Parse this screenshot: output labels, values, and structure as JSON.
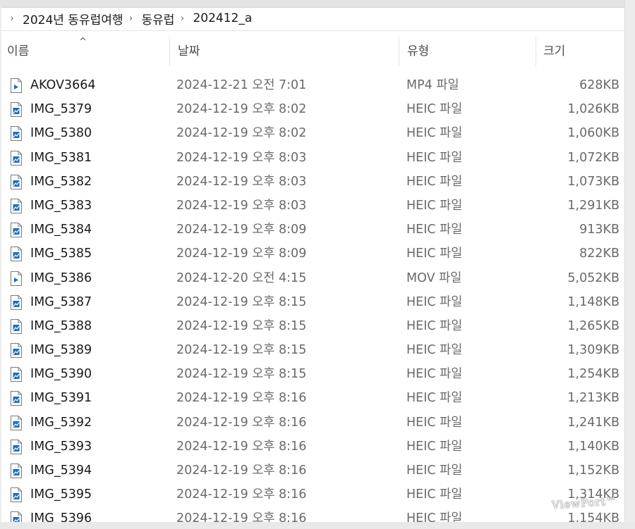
{
  "breadcrumb": {
    "items": [
      "2024년 동유럽여행",
      "동유럽",
      "202412_a"
    ]
  },
  "columns": {
    "name": "이름",
    "date": "날짜",
    "type": "유형",
    "size": "크기"
  },
  "sort": {
    "column": "name",
    "direction": "ascending",
    "icon": "chevron-up-icon"
  },
  "files": [
    {
      "name": "AKOV3664",
      "date": "2024-12-21 오전 7:01",
      "type": "MP4 파일",
      "size": "628KB",
      "icon": "video-file-icon"
    },
    {
      "name": "IMG_5379",
      "date": "2024-12-19 오후 8:02",
      "type": "HEIC 파일",
      "size": "1,026KB",
      "icon": "image-file-icon"
    },
    {
      "name": "IMG_5380",
      "date": "2024-12-19 오후 8:02",
      "type": "HEIC 파일",
      "size": "1,060KB",
      "icon": "image-file-icon"
    },
    {
      "name": "IMG_5381",
      "date": "2024-12-19 오후 8:03",
      "type": "HEIC 파일",
      "size": "1,072KB",
      "icon": "image-file-icon"
    },
    {
      "name": "IMG_5382",
      "date": "2024-12-19 오후 8:03",
      "type": "HEIC 파일",
      "size": "1,073KB",
      "icon": "image-file-icon"
    },
    {
      "name": "IMG_5383",
      "date": "2024-12-19 오후 8:03",
      "type": "HEIC 파일",
      "size": "1,291KB",
      "icon": "image-file-icon"
    },
    {
      "name": "IMG_5384",
      "date": "2024-12-19 오후 8:09",
      "type": "HEIC 파일",
      "size": "913KB",
      "icon": "image-file-icon"
    },
    {
      "name": "IMG_5385",
      "date": "2024-12-19 오후 8:09",
      "type": "HEIC 파일",
      "size": "822KB",
      "icon": "image-file-icon"
    },
    {
      "name": "IMG_5386",
      "date": "2024-12-20 오전 4:15",
      "type": "MOV 파일",
      "size": "5,052KB",
      "icon": "video-file-icon"
    },
    {
      "name": "IMG_5387",
      "date": "2024-12-19 오후 8:15",
      "type": "HEIC 파일",
      "size": "1,148KB",
      "icon": "image-file-icon"
    },
    {
      "name": "IMG_5388",
      "date": "2024-12-19 오후 8:15",
      "type": "HEIC 파일",
      "size": "1,265KB",
      "icon": "image-file-icon"
    },
    {
      "name": "IMG_5389",
      "date": "2024-12-19 오후 8:15",
      "type": "HEIC 파일",
      "size": "1,309KB",
      "icon": "image-file-icon"
    },
    {
      "name": "IMG_5390",
      "date": "2024-12-19 오후 8:15",
      "type": "HEIC 파일",
      "size": "1,254KB",
      "icon": "image-file-icon"
    },
    {
      "name": "IMG_5391",
      "date": "2024-12-19 오후 8:16",
      "type": "HEIC 파일",
      "size": "1,213KB",
      "icon": "image-file-icon"
    },
    {
      "name": "IMG_5392",
      "date": "2024-12-19 오후 8:16",
      "type": "HEIC 파일",
      "size": "1,241KB",
      "icon": "image-file-icon"
    },
    {
      "name": "IMG_5393",
      "date": "2024-12-19 오후 8:16",
      "type": "HEIC 파일",
      "size": "1,140KB",
      "icon": "image-file-icon"
    },
    {
      "name": "IMG_5394",
      "date": "2024-12-19 오후 8:16",
      "type": "HEIC 파일",
      "size": "1,152KB",
      "icon": "image-file-icon"
    },
    {
      "name": "IMG_5395",
      "date": "2024-12-19 오후 8:16",
      "type": "HEIC 파일",
      "size": "1,314KB",
      "icon": "image-file-icon"
    },
    {
      "name": "IMG_5396",
      "date": "2024-12-19 오후 8:16",
      "type": "HEIC 파일",
      "size": "1,154KB",
      "icon": "image-file-icon"
    }
  ],
  "watermark": "ViewPort™",
  "colors": {
    "icon_blue": "#1a6fc0",
    "text_primary": "#1a1a1a",
    "text_secondary": "#6a6a6a"
  }
}
